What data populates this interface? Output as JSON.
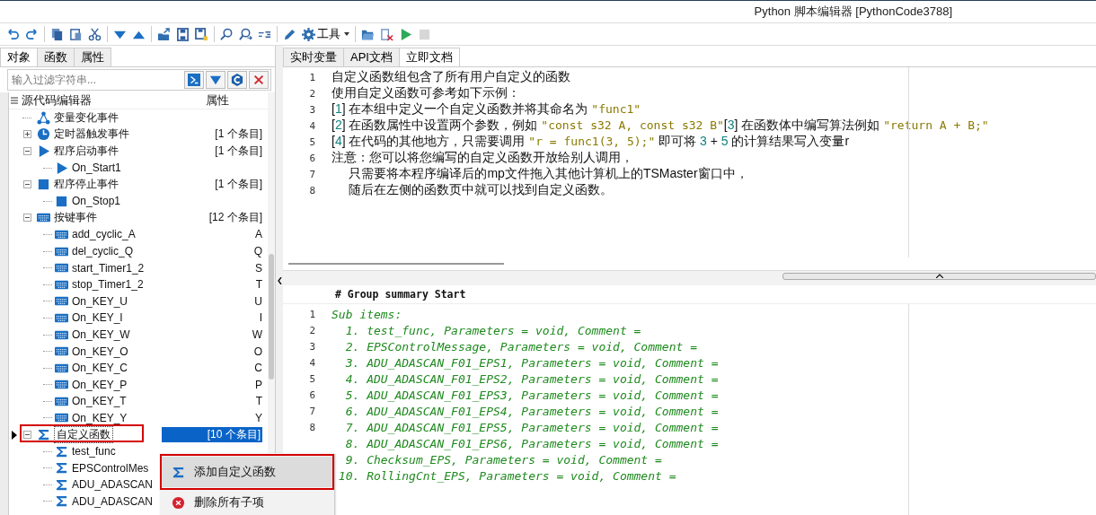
{
  "window": {
    "title": "Python 脚本编辑器 [PythonCode3788]"
  },
  "toolbar": {
    "groups": [
      [
        {
          "kind": "undo",
          "disabled": false
        },
        {
          "kind": "redo",
          "disabled": false
        }
      ],
      [
        {
          "kind": "copy",
          "disabled": false
        },
        {
          "kind": "paste",
          "disabled": false
        },
        {
          "kind": "cut",
          "disabled": false
        }
      ],
      [
        {
          "kind": "down",
          "disabled": false
        },
        {
          "kind": "up",
          "disabled": false
        }
      ],
      [
        {
          "kind": "export",
          "disabled": false
        },
        {
          "kind": "save",
          "disabled": false
        },
        {
          "kind": "saveas",
          "disabled": false
        }
      ],
      [
        {
          "kind": "find",
          "disabled": false
        },
        {
          "kind": "findnext",
          "disabled": false
        },
        {
          "kind": "replace",
          "disabled": false
        }
      ],
      [
        {
          "kind": "pencil",
          "disabled": false
        },
        {
          "kind": "tools",
          "label": "工具",
          "disabled": false
        }
      ],
      [
        {
          "kind": "folder",
          "disabled": false
        },
        {
          "kind": "clear",
          "disabled": false
        },
        {
          "kind": "run",
          "disabled": false
        },
        {
          "kind": "stop",
          "disabled": true
        }
      ]
    ]
  },
  "left_tabs": [
    {
      "label": "对象",
      "selected": true
    },
    {
      "label": "函数",
      "selected": false
    },
    {
      "label": "属性",
      "selected": false
    }
  ],
  "filter": {
    "placeholder": "输入过滤字符串..."
  },
  "tree": {
    "columns": [
      "源代码编辑器",
      "属性"
    ],
    "items": [
      {
        "kind": "var",
        "label": "变量变化事件",
        "selected": false
      },
      {
        "kind": "timer",
        "label": "定时器触发事件",
        "attr": "[1 个条目]",
        "expanded": false,
        "selected": false
      },
      {
        "kind": "start",
        "label": "程序启动事件",
        "attr": "[1 个条目]",
        "expanded": true,
        "selected": false,
        "children": [
          {
            "kind": "start",
            "label": "On_Start1",
            "selected": false
          }
        ]
      },
      {
        "kind": "stop",
        "label": "程序停止事件",
        "attr": "[1 个条目]",
        "expanded": true,
        "selected": false,
        "children": [
          {
            "kind": "stop",
            "label": "On_Stop1",
            "selected": false
          }
        ]
      },
      {
        "kind": "key",
        "label": "按键事件",
        "attr": "[12 个条目]",
        "expanded": true,
        "selected": false,
        "children": [
          {
            "kind": "key",
            "label": "add_cyclic_A",
            "attr": "A",
            "selected": false
          },
          {
            "kind": "key",
            "label": "del_cyclic_Q",
            "attr": "Q",
            "selected": false
          },
          {
            "kind": "key",
            "label": "start_Timer1_2",
            "attr": "S",
            "selected": false
          },
          {
            "kind": "key",
            "label": "stop_Timer1_2",
            "attr": "T",
            "selected": false
          },
          {
            "kind": "key",
            "label": "On_KEY_U",
            "attr": "U",
            "selected": false
          },
          {
            "kind": "key",
            "label": "On_KEY_I",
            "attr": "I",
            "selected": false
          },
          {
            "kind": "key",
            "label": "On_KEY_W",
            "attr": "W",
            "selected": false
          },
          {
            "kind": "key",
            "label": "On_KEY_O",
            "attr": "O",
            "selected": false
          },
          {
            "kind": "key",
            "label": "On_KEY_C",
            "attr": "C",
            "selected": false
          },
          {
            "kind": "key",
            "label": "On_KEY_P",
            "attr": "P",
            "selected": false
          },
          {
            "kind": "key",
            "label": "On_KEY_T",
            "attr": "T",
            "selected": false
          },
          {
            "kind": "key",
            "label": "On_KEY_Y",
            "attr": "Y",
            "selected": false
          }
        ]
      },
      {
        "kind": "sigma",
        "label": "自定义函数",
        "attr": "[10 个条目]",
        "expanded": true,
        "selected": true,
        "annotated": true,
        "children": [
          {
            "kind": "sigma",
            "label": "test_func",
            "selected": false
          },
          {
            "kind": "sigma",
            "label": "EPSControlMes",
            "selected": false
          },
          {
            "kind": "sigma",
            "label": "ADU_ADASCAN",
            "selected": false
          },
          {
            "kind": "sigma",
            "label": "ADU_ADASCAN",
            "selected": false
          }
        ]
      }
    ]
  },
  "context_menu": [
    {
      "kind": "sigma",
      "label": "添加自定义函数",
      "selected": true,
      "annotated": true
    },
    {
      "kind": "delete",
      "label": "删除所有子项",
      "selected": false,
      "annotated": false
    }
  ],
  "right_tabs": [
    {
      "label": "实时变量",
      "selected": false
    },
    {
      "label": "API文档",
      "selected": false
    },
    {
      "label": "立即文档",
      "selected": true
    }
  ],
  "doc_lines": [
    {
      "n": "1",
      "segs": [
        {
          "kind": "text",
          "t": "自定义函数组包含了所有用户自定义的函数"
        }
      ]
    },
    {
      "n": "2",
      "segs": [
        {
          "kind": "text",
          "t": "使用自定义函数可参考如下示例："
        }
      ]
    },
    {
      "n": "3",
      "segs": [
        {
          "kind": "text",
          "t": "["
        },
        {
          "kind": "num",
          "t": "1"
        },
        {
          "kind": "text",
          "t": "] 在本组中定义一个自定义函数并将其命名为 "
        },
        {
          "kind": "str",
          "t": "\"func1\""
        }
      ]
    },
    {
      "n": "4",
      "segs": [
        {
          "kind": "text",
          "t": "["
        },
        {
          "kind": "num",
          "t": "2"
        },
        {
          "kind": "text",
          "t": "] 在函数属性中设置两个参数，例如 "
        },
        {
          "kind": "str",
          "t": "\"const s32 A, const s32 B\""
        },
        {
          "kind": "text",
          "t": "["
        },
        {
          "kind": "num",
          "t": "3"
        },
        {
          "kind": "text",
          "t": "] 在函数体中编写算法例如 "
        },
        {
          "kind": "str",
          "t": "\"return A + B;\""
        }
      ]
    },
    {
      "n": "5",
      "segs": [
        {
          "kind": "text",
          "t": "["
        },
        {
          "kind": "num",
          "t": "4"
        },
        {
          "kind": "text",
          "t": "] 在代码的其他地方，只需要调用 "
        },
        {
          "kind": "str",
          "t": "\"r = func1(3, 5);\""
        },
        {
          "kind": "text",
          "t": " 即可将 "
        },
        {
          "kind": "num",
          "t": "3"
        },
        {
          "kind": "text",
          "t": " + "
        },
        {
          "kind": "num",
          "t": "5"
        },
        {
          "kind": "text",
          "t": " 的计算结果写入变量r"
        }
      ]
    },
    {
      "n": "6",
      "segs": [
        {
          "kind": "text",
          "t": "注意：您可以将您编写的自定义函数开放给别人调用，"
        }
      ]
    },
    {
      "n": "7",
      "segs": [
        {
          "kind": "text",
          "t": "     只需要将本程序编译后的mp文件拖入其他计算机上的TSMaster窗口中，"
        }
      ]
    },
    {
      "n": "8",
      "segs": [
        {
          "kind": "text",
          "t": "     随后在左侧的函数页中就可以找到自定义函数。"
        }
      ]
    }
  ],
  "summary": {
    "header": "# Group summary Start",
    "lines": [
      {
        "n": "1",
        "t": "Sub items:"
      },
      {
        "n": "2",
        "t": "  1. test_func, Parameters = void, Comment ="
      },
      {
        "n": "3",
        "t": "  2. EPSControlMessage, Parameters = void, Comment ="
      },
      {
        "n": "4",
        "t": "  3. ADU_ADASCAN_F01_EPS1, Parameters = void, Comment ="
      },
      {
        "n": "5",
        "t": "  4. ADU_ADASCAN_F01_EPS2, Parameters = void, Comment ="
      },
      {
        "n": "6",
        "t": "  5. ADU_ADASCAN_F01_EPS3, Parameters = void, Comment ="
      },
      {
        "n": "7",
        "t": "  6. ADU_ADASCAN_F01_EPS4, Parameters = void, Comment ="
      },
      {
        "n": "8",
        "t": "  7. ADU_ADASCAN_F01_EPS5, Parameters = void, Comment ="
      },
      {
        "t": "  8. ADU_ADASCAN_F01_EPS6, Parameters = void, Comment ="
      },
      {
        "t": "  9. Checksum_EPS, Parameters = void, Comment ="
      },
      {
        "t": " 10. RollingCnt_EPS, Parameters = void, Comment ="
      }
    ]
  }
}
